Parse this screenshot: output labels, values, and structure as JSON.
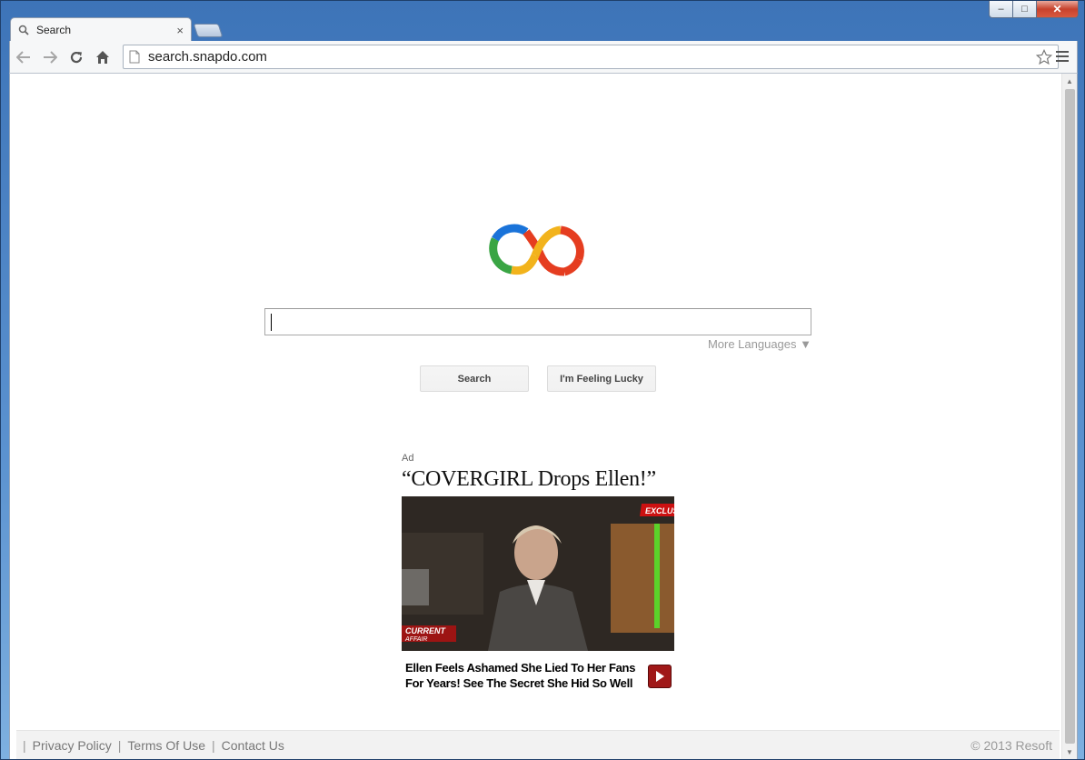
{
  "window": {
    "controls": {
      "minimize": "–",
      "maximize": "□",
      "close": "✕"
    }
  },
  "tab": {
    "title": "Search",
    "close": "×",
    "icon": "search-icon"
  },
  "toolbar": {
    "url": "search.snapdo.com",
    "icons": [
      "back-arrow-icon",
      "forward-arrow-icon",
      "reload-icon",
      "home-icon",
      "page-icon",
      "star-icon",
      "menu-icon"
    ]
  },
  "search": {
    "value": "",
    "more_languages": "More Languages ▼",
    "search_button": "Search",
    "lucky_button": "I'm Feeling Lucky"
  },
  "ad": {
    "label": "Ad",
    "headline": "“COVERGIRL Drops Ellen!”",
    "overlay_exclusive": "EXCLUS",
    "overlay_current": "CURRENT",
    "overlay_affair": "AFFAIR",
    "text_line1": "Ellen Feels Ashamed She Lied To Her Fans",
    "text_line2": "For Years! See The Secret She Hid So Well"
  },
  "footer": {
    "links": [
      "Privacy Policy",
      "Terms Of Use",
      "Contact Us"
    ],
    "copyright": "© 2013 Resoft"
  },
  "colors": {
    "logo_blue": "#1a73d9",
    "logo_green": "#3aa544",
    "logo_yellow": "#f2b31c",
    "logo_red": "#e53d20"
  }
}
